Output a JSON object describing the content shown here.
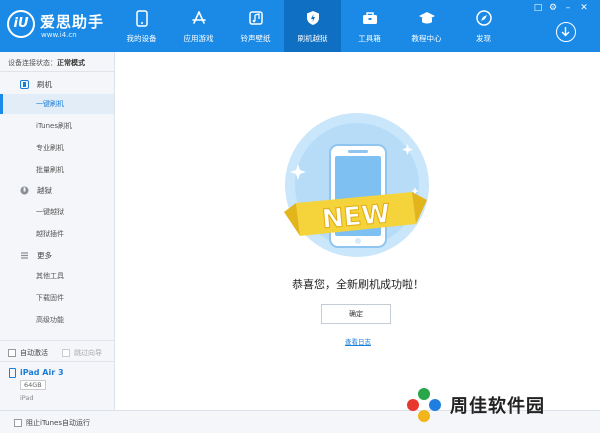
{
  "app": {
    "logo_mark": "iU",
    "name": "爱思助手",
    "url": "www.i4.cn"
  },
  "nav": [
    {
      "label": "我的设备",
      "icon": "phone-icon"
    },
    {
      "label": "应用游戏",
      "icon": "app-store-icon"
    },
    {
      "label": "铃声壁纸",
      "icon": "music-icon"
    },
    {
      "label": "刷机越狱",
      "icon": "shield-icon",
      "active": true
    },
    {
      "label": "工具箱",
      "icon": "toolbox-icon"
    },
    {
      "label": "教程中心",
      "icon": "graduation-cap-icon"
    },
    {
      "label": "发现",
      "icon": "compass-icon"
    }
  ],
  "sidebar": {
    "status_label": "设备连接状态：",
    "status_value": "正常模式",
    "groups": [
      {
        "label": "刷机",
        "icon": "flash-icon",
        "items": [
          "一键刷机",
          "iTunes刷机",
          "专业刷机",
          "批量刷机"
        ]
      },
      {
        "label": "越狱",
        "icon": "jailbreak-icon",
        "items": [
          "一键越狱",
          "越狱插件"
        ]
      },
      {
        "label": "更多",
        "icon": "menu-icon",
        "items": [
          "其他工具",
          "下载固件",
          "高级功能"
        ]
      }
    ],
    "auto_activate": "自动激活",
    "skip_guide": "跳过向导",
    "device": {
      "name": "iPad Air 3",
      "capacity": "64GB",
      "model": "iPad"
    }
  },
  "bottom": {
    "prevent_itunes": "阻止iTunes自动运行"
  },
  "main": {
    "badge_text": "NEW",
    "success_message": "恭喜您，全新刷机成功啦！",
    "confirm_button": "确定",
    "view_log": "查看日志"
  },
  "watermark": {
    "text": "周佳软件园"
  },
  "colors": {
    "accent": "#1a8ae6",
    "accent_dark": "#0f6fc2",
    "badge": "#f5d33a"
  }
}
